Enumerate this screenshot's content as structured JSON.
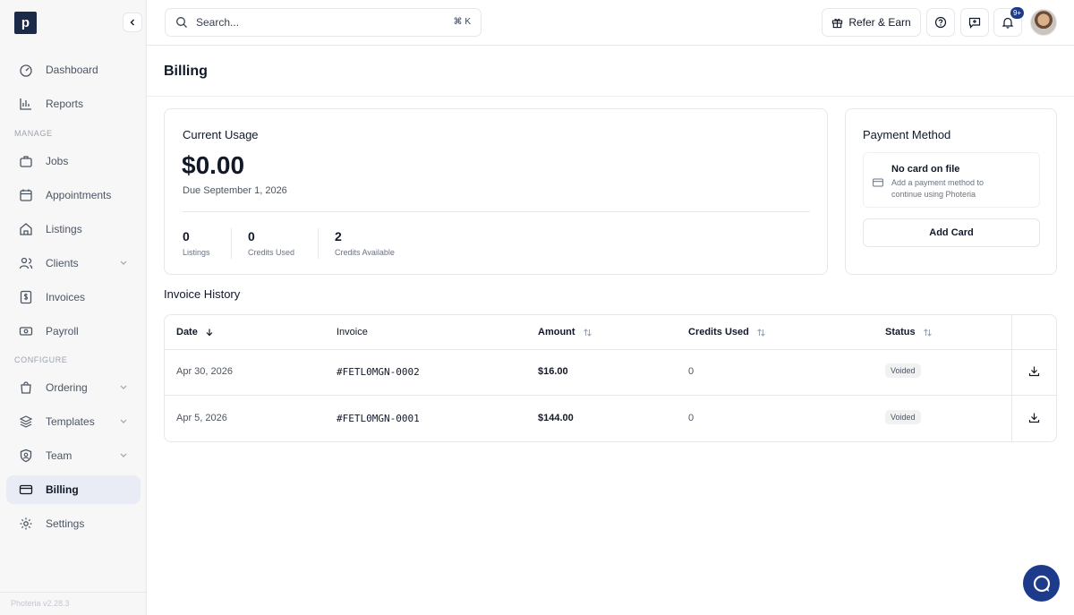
{
  "app": {
    "logo_letter": "p",
    "version": "Photeria v2.28.3"
  },
  "sidebar": {
    "items": [
      {
        "label": "Dashboard"
      },
      {
        "label": "Reports"
      },
      {
        "label": "Jobs"
      },
      {
        "label": "Appointments"
      },
      {
        "label": "Listings"
      },
      {
        "label": "Clients"
      },
      {
        "label": "Invoices"
      },
      {
        "label": "Payroll"
      },
      {
        "label": "Ordering"
      },
      {
        "label": "Templates"
      },
      {
        "label": "Team"
      },
      {
        "label": "Billing"
      },
      {
        "label": "Settings"
      }
    ],
    "sections": {
      "manage": "MANAGE",
      "configure": "CONFIGURE"
    },
    "active": "Billing"
  },
  "topbar": {
    "search_placeholder": "Search...",
    "search_shortcut": "⌘ K",
    "refer_label": "Refer & Earn",
    "notification_count": "9+"
  },
  "page": {
    "title": "Billing"
  },
  "usage": {
    "heading": "Current Usage",
    "amount": "$0.00",
    "due": "Due September 1, 2026",
    "stats": [
      {
        "value": "0",
        "label": "Listings"
      },
      {
        "value": "0",
        "label": "Credits Used"
      },
      {
        "value": "2",
        "label": "Credits Available"
      }
    ]
  },
  "payment": {
    "heading": "Payment Method",
    "no_card_title": "No card on file",
    "no_card_desc": "Add a payment method to continue using Photeria",
    "add_card_label": "Add Card"
  },
  "invoices": {
    "heading": "Invoice History",
    "columns": [
      "Date",
      "Invoice",
      "Amount",
      "Credits Used",
      "Status"
    ],
    "rows": [
      {
        "date": "Apr 30, 2026",
        "invoice": "#FETL0MGN-0002",
        "amount": "$16.00",
        "credits": "0",
        "status": "Voided"
      },
      {
        "date": "Apr 5, 2026",
        "invoice": "#FETL0MGN-0001",
        "amount": "$144.00",
        "credits": "0",
        "status": "Voided"
      }
    ]
  }
}
